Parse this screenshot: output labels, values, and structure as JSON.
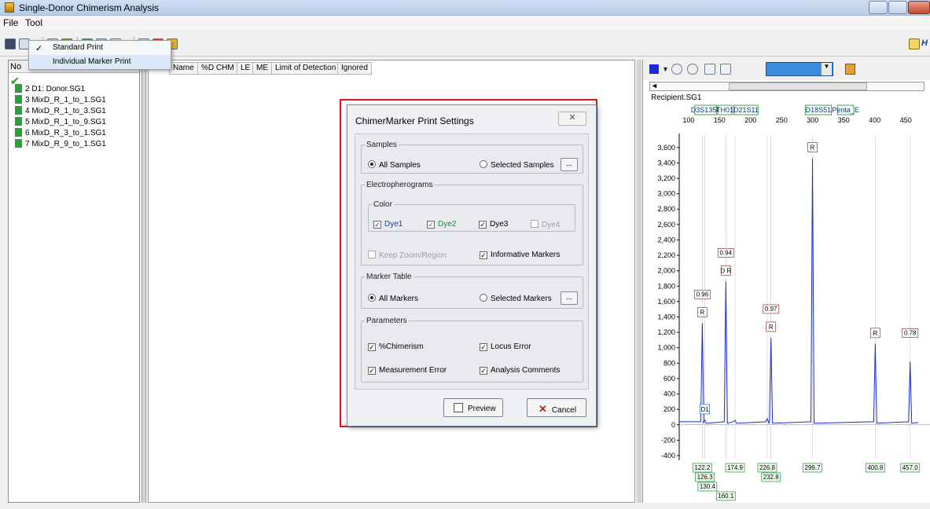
{
  "window": {
    "title": "Single-Donor Chimerism Analysis"
  },
  "menu": [
    "File",
    "Tool"
  ],
  "print_dropdown": {
    "items": [
      {
        "label": "Standard Print",
        "checked": true
      },
      {
        "label": "Individual Marker Print",
        "checked": false
      }
    ]
  },
  "samples_panel": {
    "header": "No",
    "rows": [
      "2  D1: Donor.SG1",
      "3  MixD_R_1_to_1.SG1",
      "4  MixD_R_1_to_3.SG1",
      "5  MixD_R_1_to_9.SG1",
      "6  MixD_R_3_to_1.SG1",
      "7  MixD_R_9_to_1.SG1"
    ]
  },
  "table_headers": [
    "Name",
    "%D CHM",
    "LE",
    "ME",
    "Limit of Detection",
    "Ignored"
  ],
  "chart_panel": {
    "sample_label": "Recipient.SG1",
    "marker_labels": [
      "D3S1358",
      "TH01",
      "D21S11",
      "D18S51",
      "Penta_E"
    ],
    "color": "#1d2bd1"
  },
  "dialog": {
    "title": "ChimerMarker Print Settings",
    "close_label": "✕",
    "samples": {
      "legend": "Samples",
      "all": "All Samples",
      "selected": "Selected Samples",
      "more": "..."
    },
    "electro": {
      "legend": "Electropherograms",
      "color_legend": "Color",
      "dye1": "Dye1",
      "dye2": "Dye2",
      "dye3": "Dye3",
      "dye4": "Dye4",
      "keep_zoom": "Keep Zoom/Region",
      "informative": "Informative Markers"
    },
    "marker_table": {
      "legend": "Marker Table",
      "all": "All Markers",
      "selected": "Selected Markers",
      "more": "..."
    },
    "parameters": {
      "legend": "Parameters",
      "chimerism": "%Chimerism",
      "locus_error": "Locus Error",
      "measurement_error": "Measurement Error",
      "analysis_comments": "Analysis Comments"
    },
    "preview_label": "Preview",
    "cancel_label": "Cancel"
  },
  "chart_data": {
    "type": "line",
    "title": "Recipient.SG1",
    "x_ticks": [
      100,
      150,
      200,
      250,
      300,
      350,
      400,
      450
    ],
    "y_ticks": [
      3600,
      3400,
      3200,
      3000,
      2800,
      2600,
      2400,
      2200,
      2000,
      1800,
      1600,
      1400,
      1200,
      1000,
      800,
      600,
      400,
      200,
      0,
      -200,
      -400
    ],
    "xlim": [
      85,
      470
    ],
    "ylim": [
      -400,
      3700
    ],
    "peaks": [
      {
        "x": 122.2,
        "height": 1320,
        "label": "R",
        "ratio": "0.96"
      },
      {
        "x": 126.3,
        "height": 60,
        "label": "D1"
      },
      {
        "x": 160.1,
        "height": 1860,
        "label": "D R",
        "ratio": "0.94"
      },
      {
        "x": 174.9,
        "height": 60
      },
      {
        "x": 226.8,
        "height": 80
      },
      {
        "x": 232.8,
        "height": 1130,
        "label": "R",
        "ratio": "0.97"
      },
      {
        "x": 299.7,
        "height": 3460,
        "label": "R"
      },
      {
        "x": 400.8,
        "height": 1050,
        "label": "R"
      },
      {
        "x": 457.0,
        "height": 820,
        "ratio": "0.78"
      }
    ],
    "size_labels": [
      "122.2",
      "126.3",
      "130.4",
      "160.1",
      "174.9",
      "226.8",
      "232.8",
      "299.7",
      "400.8",
      "457.0"
    ]
  }
}
